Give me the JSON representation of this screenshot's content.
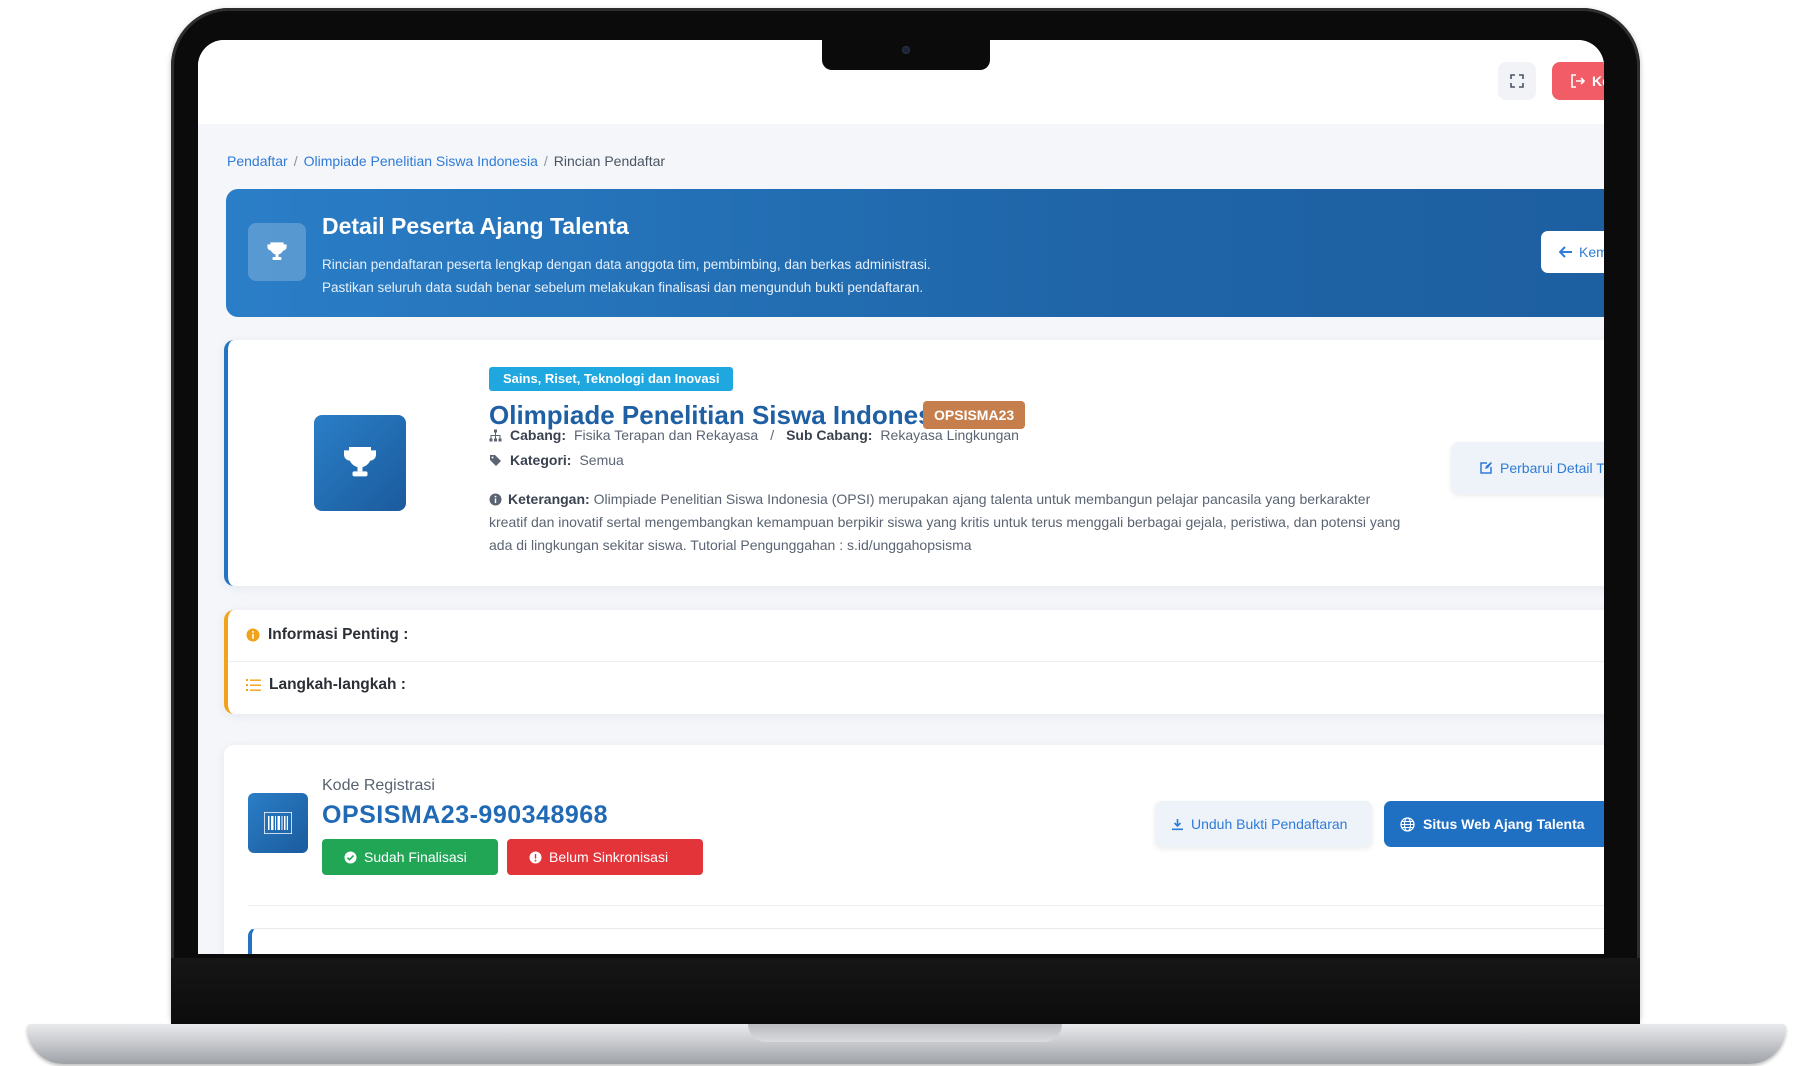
{
  "topbar": {
    "logout_label": "Ke"
  },
  "breadcrumb": {
    "items": [
      "Pendaftar",
      "Olimpiade Penelitian Siswa Indonesia"
    ],
    "current": "Rincian Pendaftar",
    "separator": "/"
  },
  "hero": {
    "title": "Detail Peserta Ajang Talenta",
    "desc_line1": "Rincian pendaftaran peserta lengkap dengan data anggota tim, pembimbing, dan berkas administrasi.",
    "desc_line2": "Pastikan seluruh data sudah benar sebelum melakukan finalisasi dan mengunduh bukti pendaftaran.",
    "back_label": "Kemb"
  },
  "event": {
    "category_badge": "Sains, Riset, Teknologi dan Inovasi",
    "title": "Olimpiade Penelitian Siswa Indonesia",
    "code_badge": "OPSISMA23",
    "cabang_label": "Cabang:",
    "cabang_value": "Fisika Terapan dan Rekayasa",
    "sub_separator": "/",
    "sub_cabang_label": "Sub Cabang:",
    "sub_cabang_value": "Rekayasa Lingkungan",
    "kategori_label": "Kategori:",
    "kategori_value": "Semua",
    "keterangan_label": "Keterangan:",
    "keterangan_value": "Olimpiade Penelitian Siswa Indonesia (OPSI) merupakan ajang talenta untuk membangun pelajar pancasila yang berkarakter kreatif dan inovatif sertal mengembangkan kemampuan berpikir siswa yang kritis untuk terus menggali berbagai gejala, peristiwa, dan potensi yang ada di lingkungan sekitar siswa. Tutorial Pengunggahan : s.id/unggahopsisma",
    "update_button": "Perbarui Detail Tim"
  },
  "notice": {
    "important_label": "Informasi Penting :",
    "steps_label": "Langkah-langkah :"
  },
  "registration": {
    "label": "Kode Registrasi",
    "code": "OPSISMA23-990348968",
    "status_final": "Sudah Finalisasi",
    "status_sync": "Belum Sinkronisasi",
    "download_button": "Unduh Bukti Pendaftaran",
    "site_button": "Situs Web Ajang Talenta"
  },
  "icons": {
    "fullscreen": "expand-icon",
    "logout": "sign-out-icon",
    "trophy": "trophy-icon",
    "back": "arrow-left-icon",
    "sitemap": "sitemap-icon",
    "tag": "tag-icon",
    "info": "info-circle-icon",
    "edit": "edit-icon",
    "list": "list-icon",
    "barcode": "barcode-icon",
    "check": "check-circle-icon",
    "alert": "exclamation-circle-icon",
    "download": "download-icon",
    "globe": "globe-icon"
  },
  "colors": {
    "primary": "#1f6fc2",
    "hero_start": "#2a7ec7",
    "hero_end": "#1d5fa0",
    "category_badge": "#1fa7e0",
    "code_badge": "#c67f4c",
    "success": "#21a656",
    "danger": "#e3343a",
    "warning": "#f0a21a",
    "logout": "#f25c66"
  }
}
